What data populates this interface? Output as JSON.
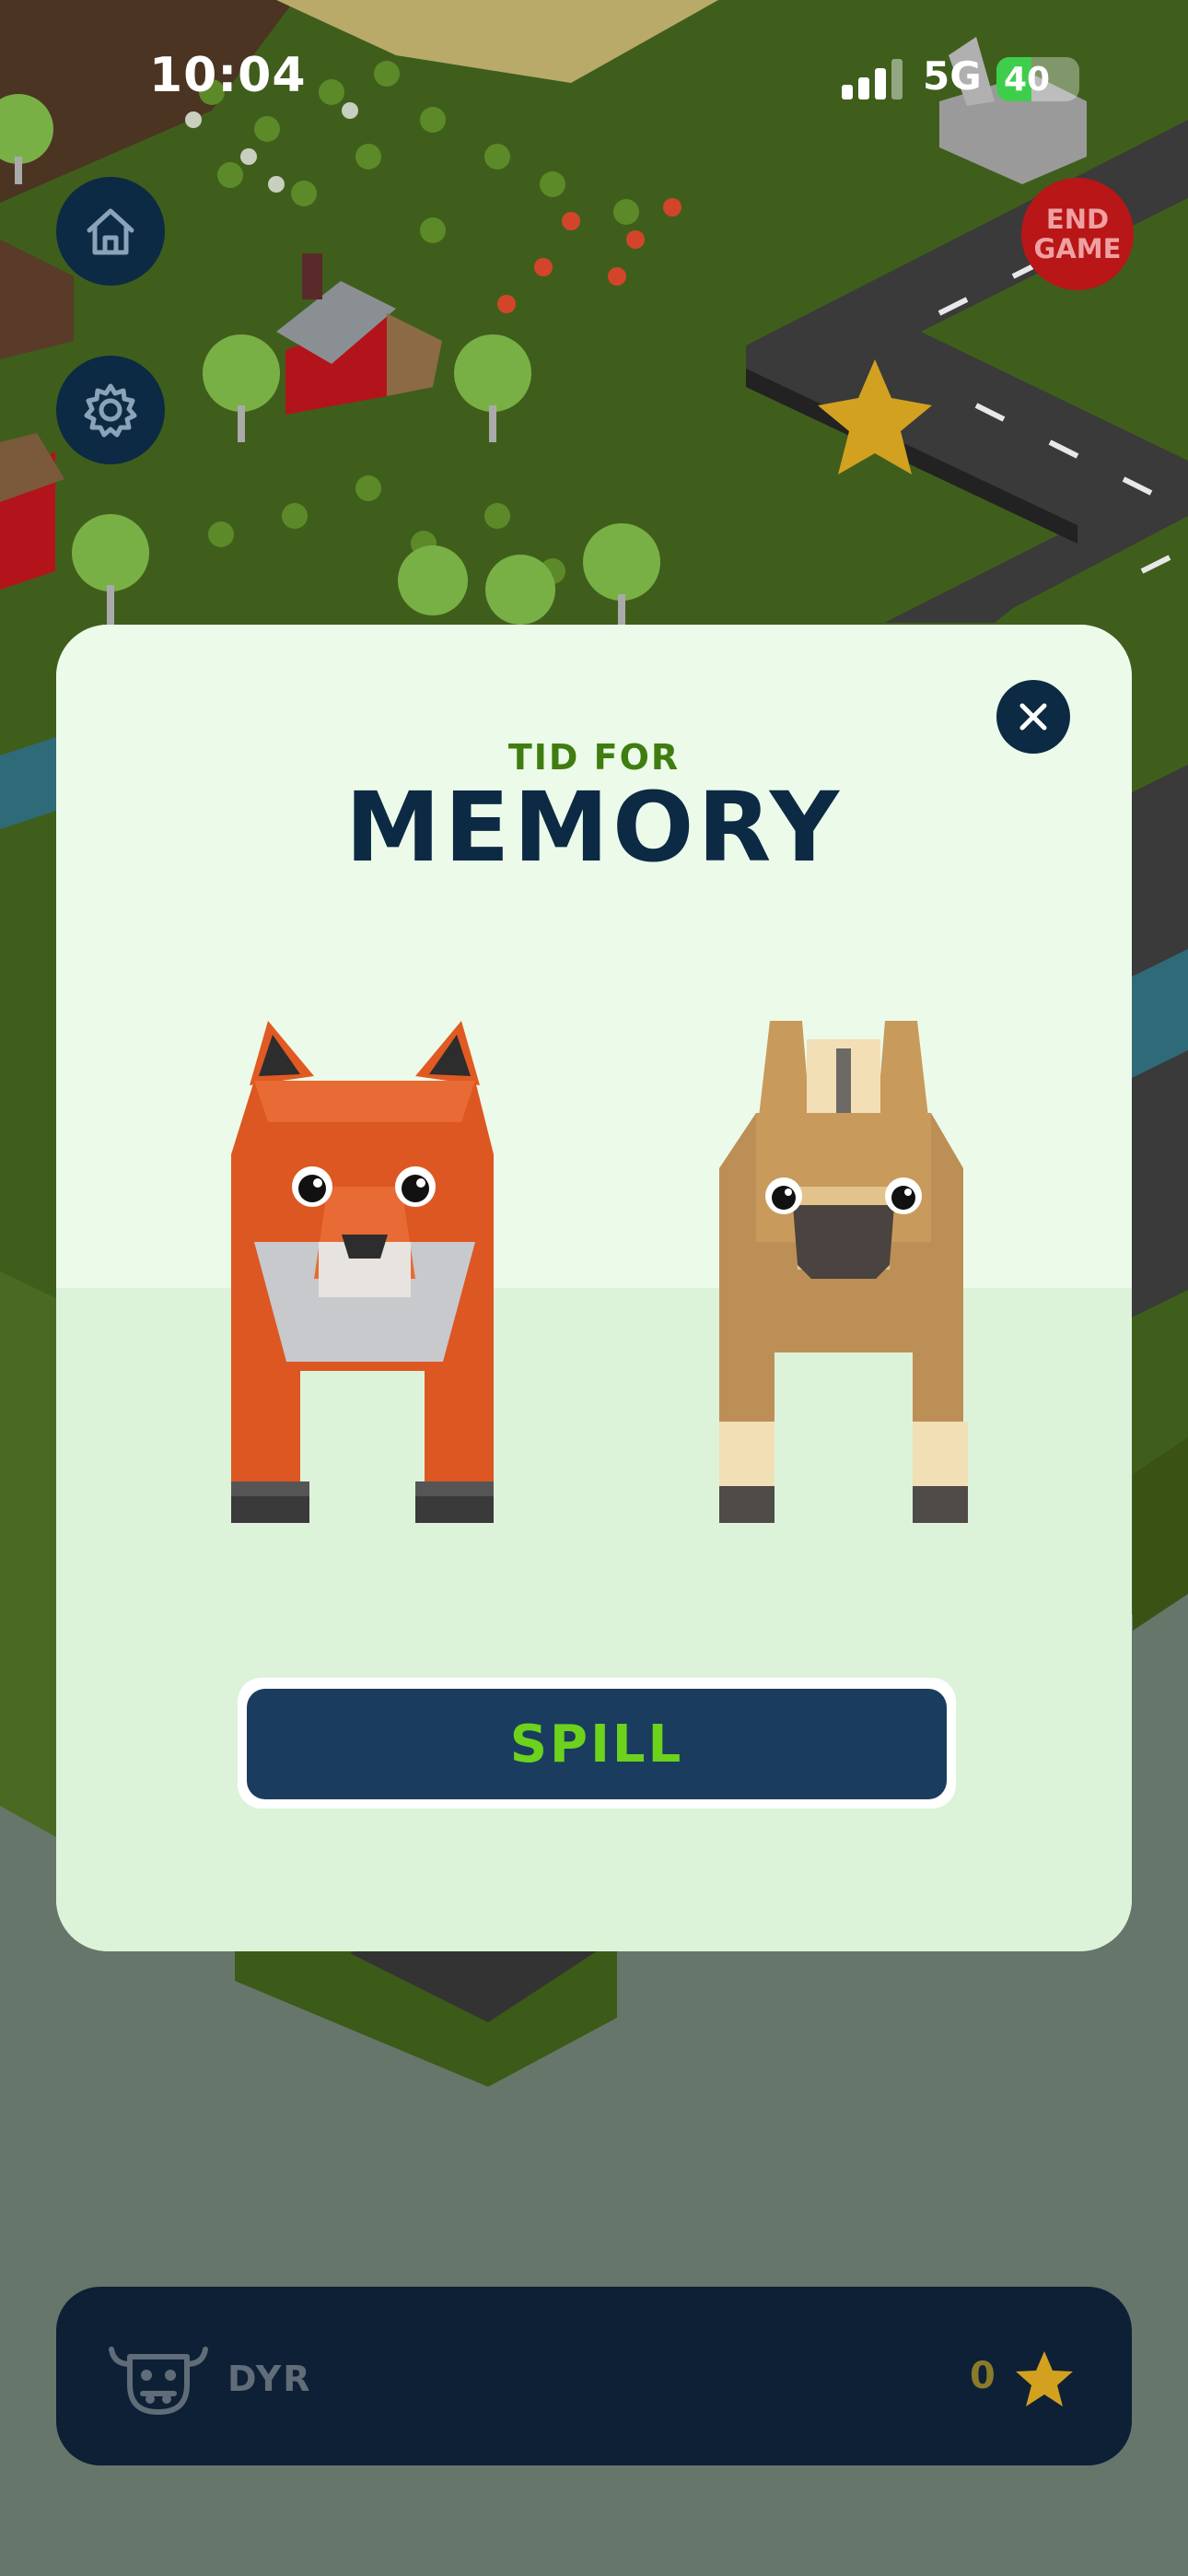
{
  "status_bar": {
    "time": "10:04",
    "network": "5G",
    "battery": "40"
  },
  "controls": {
    "end_game_line1": "END",
    "end_game_line2": "GAME"
  },
  "modal": {
    "subtitle": "TID FOR",
    "title": "MEMORY",
    "play_button": "SPILL",
    "animals": [
      "fox",
      "horse"
    ]
  },
  "bottom_bar": {
    "label": "DYR",
    "star_count": "0"
  },
  "colors": {
    "navy": "#0c2a44",
    "button_text_green": "#6dd21c",
    "subtitle_green": "#3f7d10",
    "end_game_red": "#b81617",
    "modal_background": "#ecfbe9",
    "star_yellow": "#d1a11f"
  },
  "icons": {
    "home_button": "home-icon",
    "settings_button": "gear-icon",
    "close_button": "close-icon",
    "bottom_left": "cow-icon",
    "bottom_right": "star-icon"
  }
}
